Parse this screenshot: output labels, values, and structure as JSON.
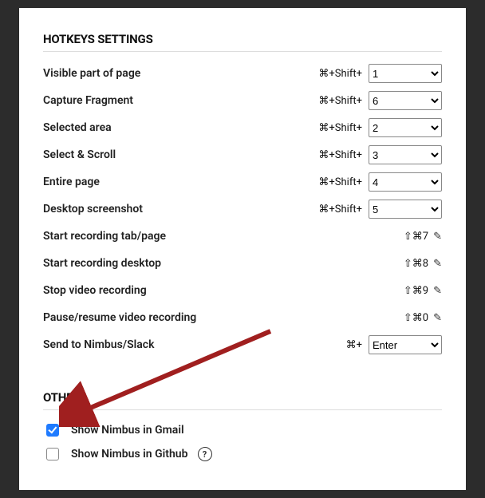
{
  "hotkeys": {
    "title": "HOTKEYS SETTINGS",
    "prefix": "⌘+Shift+",
    "rows": [
      {
        "label": "Visible part of page",
        "value": "1"
      },
      {
        "label": "Capture Fragment",
        "value": "6"
      },
      {
        "label": "Selected area",
        "value": "2"
      },
      {
        "label": "Select & Scroll",
        "value": "3"
      },
      {
        "label": "Entire page",
        "value": "4"
      },
      {
        "label": "Desktop screenshot",
        "value": "5"
      }
    ],
    "editRows": [
      {
        "label": "Start recording tab/page",
        "combo": "⇧⌘7"
      },
      {
        "label": "Start recording desktop",
        "combo": "⇧⌘8"
      },
      {
        "label": "Stop video recording",
        "combo": "⇧⌘9"
      },
      {
        "label": "Pause/resume video recording",
        "combo": "⇧⌘0"
      }
    ],
    "send": {
      "label": "Send to Nimbus/Slack",
      "prefix": "⌘+",
      "value": "Enter"
    }
  },
  "other": {
    "title": "OTHER",
    "items": [
      {
        "label": "Show Nimbus in Gmail",
        "checked": true,
        "help": false
      },
      {
        "label": "Show Nimbus in Github",
        "checked": false,
        "help": true
      }
    ]
  }
}
